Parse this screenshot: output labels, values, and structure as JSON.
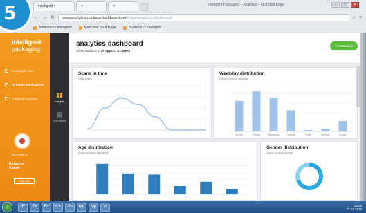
{
  "badge": {
    "number": "5"
  },
  "browser": {
    "tabs": [
      {
        "label": "intelligent ×"
      },
      {
        "label": "×"
      },
      {
        "label": "×"
      }
    ],
    "window_title": "Intelligent Packaging – Analytics – Microsoft Edge",
    "address": {
      "url": "www.analytics.packagedashboard.net",
      "path": "/#!app/analytics/dashboard"
    },
    "bookmarks": [
      {
        "label": "Bookmarks Intelligent"
      },
      {
        "label": "Welcome Start Page"
      },
      {
        "label": "Bookmarks Intelligent"
      }
    ]
  },
  "sidebar": {
    "brand_line1": "intelligent",
    "brand_line2": "packaging",
    "nav": [
      {
        "label": "Campaign Sites"
      },
      {
        "label": "Dynamic Applications"
      },
      {
        "label": "Tracking Functions"
      }
    ],
    "avatar_label": "BOTANICA",
    "user_line1": "Botanica",
    "user_line2": "Admin",
    "logout_label": "Log out"
  },
  "rail": {
    "items": [
      {
        "label": "Insights",
        "icon": "bar-chart-icon"
      },
      {
        "label": "Operations",
        "icon": "grid-icon"
      }
    ]
  },
  "header": {
    "title": "analytics dashboard",
    "subtitle_prefix": "Show statistics of",
    "subtitle_link1": "all apps",
    "subtitle_mid": "in last",
    "subtitle_link2": "week",
    "action_label": "Customize"
  },
  "cards": {
    "scans": {
      "title": "Scans in time",
      "subtitle": "Daily scans"
    },
    "weekday": {
      "title": "Weekday distribution",
      "subtitle": "Scans count by weekday"
    },
    "age": {
      "title": "Age distribution",
      "subtitle": "Scans count by age group"
    },
    "gender": {
      "title": "Gender distribution",
      "subtitle": "Scans count by gender"
    }
  },
  "chart_data": [
    {
      "type": "line",
      "title": "Scans in time",
      "x": [
        "",
        "",
        "",
        "",
        "",
        "",
        "",
        ""
      ],
      "values": [
        2,
        40,
        58,
        46,
        24,
        0,
        0,
        0
      ],
      "ylim": [
        0,
        80
      ]
    },
    {
      "type": "bar",
      "title": "Weekday distribution",
      "categories": [
        "Monday",
        "Tuesday",
        "Wednesday",
        "Thursday",
        "Friday",
        "Saturday",
        "Sunday"
      ],
      "values": [
        65,
        85,
        72,
        45,
        3,
        6,
        22
      ],
      "ylim": [
        0,
        100
      ]
    },
    {
      "type": "bar",
      "title": "Age distribution",
      "categories": [
        "",
        "",
        "",
        "",
        "",
        ""
      ],
      "values": [
        85,
        58,
        55,
        23,
        35,
        15
      ],
      "ylim": [
        0,
        100
      ]
    },
    {
      "type": "pie",
      "title": "Gender distribution",
      "categories": [
        "",
        ""
      ],
      "values": [
        70,
        30
      ],
      "colors": [
        "#2aa9e0",
        "#8cd3f2"
      ]
    }
  ],
  "taskbar": {
    "apps": [
      "IE",
      "Ex",
      "Fo",
      "Ch",
      "Ph",
      "Mu",
      "Mp",
      "Vi"
    ],
    "time": "15:20",
    "date": "22.04.2016"
  }
}
